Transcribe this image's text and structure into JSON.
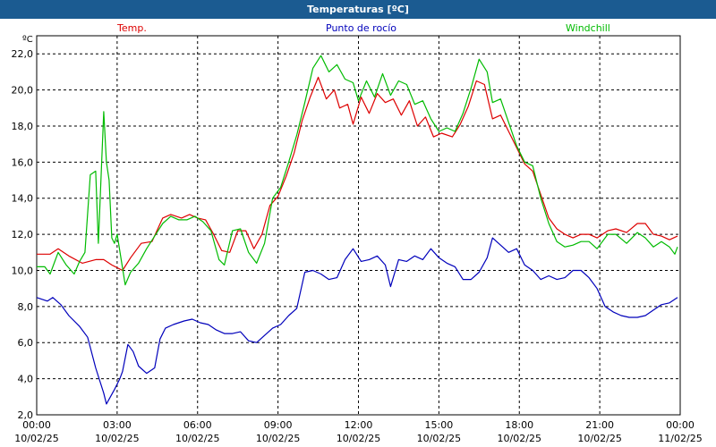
{
  "chart_data": {
    "type": "line",
    "title": "Temperaturas [ºC]",
    "ylabel": "ºC",
    "ylim": [
      2.0,
      23.0
    ],
    "y_ticks": [
      "2,0",
      "4,0",
      "6,0",
      "8,0",
      "10,0",
      "12,0",
      "14,0",
      "16,0",
      "18,0",
      "20,0",
      "22,0"
    ],
    "y_tick_values": [
      2,
      4,
      6,
      8,
      10,
      12,
      14,
      16,
      18,
      20,
      22
    ],
    "xlim": [
      0,
      24
    ],
    "x_ticks": [
      {
        "time": "00:00",
        "date": "10/02/25",
        "hour": 0
      },
      {
        "time": "03:00",
        "date": "10/02/25",
        "hour": 3
      },
      {
        "time": "06:00",
        "date": "10/02/25",
        "hour": 6
      },
      {
        "time": "09:00",
        "date": "10/02/25",
        "hour": 9
      },
      {
        "time": "12:00",
        "date": "10/02/25",
        "hour": 12
      },
      {
        "time": "15:00",
        "date": "10/02/25",
        "hour": 15
      },
      {
        "time": "18:00",
        "date": "10/02/25",
        "hour": 18
      },
      {
        "time": "21:00",
        "date": "10/02/25",
        "hour": 21
      },
      {
        "time": "00:00",
        "date": "11/02/25",
        "hour": 24
      }
    ],
    "grid": true,
    "legend_position": "top",
    "series": [
      {
        "name": "Temp.",
        "color": "#dd0000",
        "points": [
          [
            0,
            10.9
          ],
          [
            0.5,
            10.9
          ],
          [
            0.8,
            11.2
          ],
          [
            1.2,
            10.8
          ],
          [
            1.7,
            10.4
          ],
          [
            2.2,
            10.6
          ],
          [
            2.5,
            10.6
          ],
          [
            2.8,
            10.3
          ],
          [
            3.2,
            10.0
          ],
          [
            3.5,
            10.7
          ],
          [
            3.9,
            11.5
          ],
          [
            4.3,
            11.6
          ],
          [
            4.7,
            12.9
          ],
          [
            5.0,
            13.1
          ],
          [
            5.4,
            12.9
          ],
          [
            5.7,
            13.1
          ],
          [
            6.0,
            12.9
          ],
          [
            6.3,
            12.8
          ],
          [
            6.6,
            12.0
          ],
          [
            6.9,
            11.1
          ],
          [
            7.2,
            11.0
          ],
          [
            7.5,
            12.2
          ],
          [
            7.8,
            12.2
          ],
          [
            8.1,
            11.2
          ],
          [
            8.4,
            12.0
          ],
          [
            8.7,
            13.6
          ],
          [
            9.0,
            14.1
          ],
          [
            9.3,
            15.2
          ],
          [
            9.6,
            16.5
          ],
          [
            9.9,
            18.3
          ],
          [
            10.2,
            19.6
          ],
          [
            10.5,
            20.7
          ],
          [
            10.8,
            19.5
          ],
          [
            11.1,
            20.0
          ],
          [
            11.3,
            19.0
          ],
          [
            11.6,
            19.2
          ],
          [
            11.8,
            18.1
          ],
          [
            12.1,
            19.6
          ],
          [
            12.4,
            18.7
          ],
          [
            12.7,
            19.8
          ],
          [
            13.0,
            19.3
          ],
          [
            13.3,
            19.5
          ],
          [
            13.6,
            18.6
          ],
          [
            13.9,
            19.4
          ],
          [
            14.2,
            18.0
          ],
          [
            14.5,
            18.5
          ],
          [
            14.8,
            17.4
          ],
          [
            15.1,
            17.6
          ],
          [
            15.5,
            17.4
          ],
          [
            15.8,
            18.1
          ],
          [
            16.1,
            19.1
          ],
          [
            16.4,
            20.5
          ],
          [
            16.7,
            20.3
          ],
          [
            17.0,
            18.4
          ],
          [
            17.3,
            18.6
          ],
          [
            17.6,
            17.7
          ],
          [
            17.9,
            16.8
          ],
          [
            18.2,
            15.9
          ],
          [
            18.5,
            15.5
          ],
          [
            18.8,
            14.2
          ],
          [
            19.1,
            12.9
          ],
          [
            19.4,
            12.3
          ],
          [
            19.7,
            12.0
          ],
          [
            20.0,
            11.8
          ],
          [
            20.3,
            12.0
          ],
          [
            20.6,
            12.0
          ],
          [
            20.9,
            11.8
          ],
          [
            21.3,
            12.2
          ],
          [
            21.6,
            12.3
          ],
          [
            22.0,
            12.1
          ],
          [
            22.4,
            12.6
          ],
          [
            22.7,
            12.6
          ],
          [
            23.0,
            12.0
          ],
          [
            23.3,
            11.9
          ],
          [
            23.6,
            11.7
          ],
          [
            23.9,
            11.9
          ]
        ]
      },
      {
        "name": "Punto de rocío",
        "color": "#0000bb",
        "points": [
          [
            0,
            8.5
          ],
          [
            0.4,
            8.3
          ],
          [
            0.6,
            8.5
          ],
          [
            0.9,
            8.1
          ],
          [
            1.2,
            7.5
          ],
          [
            1.6,
            6.9
          ],
          [
            1.9,
            6.3
          ],
          [
            2.2,
            4.6
          ],
          [
            2.5,
            3.2
          ],
          [
            2.6,
            2.6
          ],
          [
            2.9,
            3.4
          ],
          [
            3.1,
            4.0
          ],
          [
            3.2,
            4.4
          ],
          [
            3.4,
            5.9
          ],
          [
            3.6,
            5.5
          ],
          [
            3.8,
            4.7
          ],
          [
            4.1,
            4.3
          ],
          [
            4.4,
            4.6
          ],
          [
            4.6,
            6.2
          ],
          [
            4.8,
            6.8
          ],
          [
            5.1,
            7.0
          ],
          [
            5.5,
            7.2
          ],
          [
            5.8,
            7.3
          ],
          [
            6.1,
            7.1
          ],
          [
            6.4,
            7.0
          ],
          [
            6.7,
            6.7
          ],
          [
            7.0,
            6.5
          ],
          [
            7.3,
            6.5
          ],
          [
            7.6,
            6.6
          ],
          [
            7.9,
            6.1
          ],
          [
            8.2,
            6.0
          ],
          [
            8.5,
            6.4
          ],
          [
            8.8,
            6.8
          ],
          [
            9.1,
            7.0
          ],
          [
            9.4,
            7.5
          ],
          [
            9.7,
            7.9
          ],
          [
            10.0,
            9.9
          ],
          [
            10.3,
            10.0
          ],
          [
            10.6,
            9.8
          ],
          [
            10.9,
            9.5
          ],
          [
            11.2,
            9.6
          ],
          [
            11.5,
            10.6
          ],
          [
            11.8,
            11.2
          ],
          [
            12.1,
            10.5
          ],
          [
            12.4,
            10.6
          ],
          [
            12.7,
            10.8
          ],
          [
            13.0,
            10.3
          ],
          [
            13.2,
            9.1
          ],
          [
            13.5,
            10.6
          ],
          [
            13.8,
            10.5
          ],
          [
            14.1,
            10.8
          ],
          [
            14.4,
            10.6
          ],
          [
            14.7,
            11.2
          ],
          [
            15.0,
            10.7
          ],
          [
            15.3,
            10.4
          ],
          [
            15.6,
            10.2
          ],
          [
            15.9,
            9.5
          ],
          [
            16.2,
            9.5
          ],
          [
            16.5,
            9.9
          ],
          [
            16.8,
            10.7
          ],
          [
            17.0,
            11.8
          ],
          [
            17.3,
            11.4
          ],
          [
            17.6,
            11.0
          ],
          [
            17.9,
            11.2
          ],
          [
            18.2,
            10.3
          ],
          [
            18.5,
            10.0
          ],
          [
            18.8,
            9.5
          ],
          [
            19.1,
            9.7
          ],
          [
            19.4,
            9.5
          ],
          [
            19.7,
            9.6
          ],
          [
            20.0,
            10.0
          ],
          [
            20.3,
            10.0
          ],
          [
            20.6,
            9.6
          ],
          [
            20.9,
            9.0
          ],
          [
            21.2,
            8.0
          ],
          [
            21.5,
            7.7
          ],
          [
            21.8,
            7.5
          ],
          [
            22.1,
            7.4
          ],
          [
            22.4,
            7.4
          ],
          [
            22.7,
            7.5
          ],
          [
            23.0,
            7.8
          ],
          [
            23.3,
            8.1
          ],
          [
            23.6,
            8.2
          ],
          [
            23.9,
            8.5
          ]
        ]
      },
      {
        "name": "Windchill",
        "color": "#00bb00",
        "points": [
          [
            0,
            10.2
          ],
          [
            0.3,
            10.2
          ],
          [
            0.5,
            9.8
          ],
          [
            0.8,
            11.0
          ],
          [
            1.1,
            10.3
          ],
          [
            1.4,
            9.8
          ],
          [
            1.6,
            10.5
          ],
          [
            1.8,
            11.0
          ],
          [
            2.0,
            15.3
          ],
          [
            2.2,
            15.5
          ],
          [
            2.3,
            11.5
          ],
          [
            2.5,
            18.8
          ],
          [
            2.6,
            16.0
          ],
          [
            2.7,
            15.0
          ],
          [
            2.8,
            11.8
          ],
          [
            2.9,
            11.5
          ],
          [
            3.0,
            12.0
          ],
          [
            3.3,
            9.2
          ],
          [
            3.5,
            9.9
          ],
          [
            3.8,
            10.4
          ],
          [
            4.1,
            11.2
          ],
          [
            4.4,
            11.9
          ],
          [
            4.7,
            12.6
          ],
          [
            5.0,
            13.0
          ],
          [
            5.3,
            12.8
          ],
          [
            5.6,
            12.8
          ],
          [
            5.9,
            13.0
          ],
          [
            6.2,
            12.7
          ],
          [
            6.5,
            12.2
          ],
          [
            6.8,
            10.6
          ],
          [
            7.0,
            10.3
          ],
          [
            7.3,
            12.2
          ],
          [
            7.6,
            12.3
          ],
          [
            7.9,
            11.0
          ],
          [
            8.2,
            10.4
          ],
          [
            8.5,
            11.5
          ],
          [
            8.8,
            14.0
          ],
          [
            9.1,
            14.6
          ],
          [
            9.4,
            16.0
          ],
          [
            9.7,
            17.5
          ],
          [
            10.0,
            19.3
          ],
          [
            10.3,
            21.2
          ],
          [
            10.6,
            21.9
          ],
          [
            10.9,
            21.0
          ],
          [
            11.2,
            21.4
          ],
          [
            11.5,
            20.6
          ],
          [
            11.8,
            20.4
          ],
          [
            12.0,
            19.4
          ],
          [
            12.3,
            20.5
          ],
          [
            12.6,
            19.6
          ],
          [
            12.9,
            20.9
          ],
          [
            13.2,
            19.7
          ],
          [
            13.5,
            20.5
          ],
          [
            13.8,
            20.3
          ],
          [
            14.1,
            19.2
          ],
          [
            14.4,
            19.4
          ],
          [
            14.7,
            18.4
          ],
          [
            15.0,
            17.7
          ],
          [
            15.3,
            17.9
          ],
          [
            15.6,
            17.7
          ],
          [
            15.9,
            18.7
          ],
          [
            16.2,
            20.1
          ],
          [
            16.5,
            21.7
          ],
          [
            16.8,
            21.0
          ],
          [
            17.0,
            19.3
          ],
          [
            17.3,
            19.5
          ],
          [
            17.6,
            18.2
          ],
          [
            17.9,
            16.9
          ],
          [
            18.2,
            16.0
          ],
          [
            18.5,
            15.8
          ],
          [
            18.8,
            14.0
          ],
          [
            19.1,
            12.6
          ],
          [
            19.4,
            11.6
          ],
          [
            19.7,
            11.3
          ],
          [
            20.0,
            11.4
          ],
          [
            20.3,
            11.6
          ],
          [
            20.6,
            11.6
          ],
          [
            20.9,
            11.2
          ],
          [
            21.3,
            12.0
          ],
          [
            21.6,
            12.0
          ],
          [
            22.0,
            11.5
          ],
          [
            22.4,
            12.1
          ],
          [
            22.7,
            11.8
          ],
          [
            23.0,
            11.3
          ],
          [
            23.3,
            11.6
          ],
          [
            23.6,
            11.3
          ],
          [
            23.8,
            10.9
          ],
          [
            23.9,
            11.3
          ]
        ]
      }
    ]
  }
}
